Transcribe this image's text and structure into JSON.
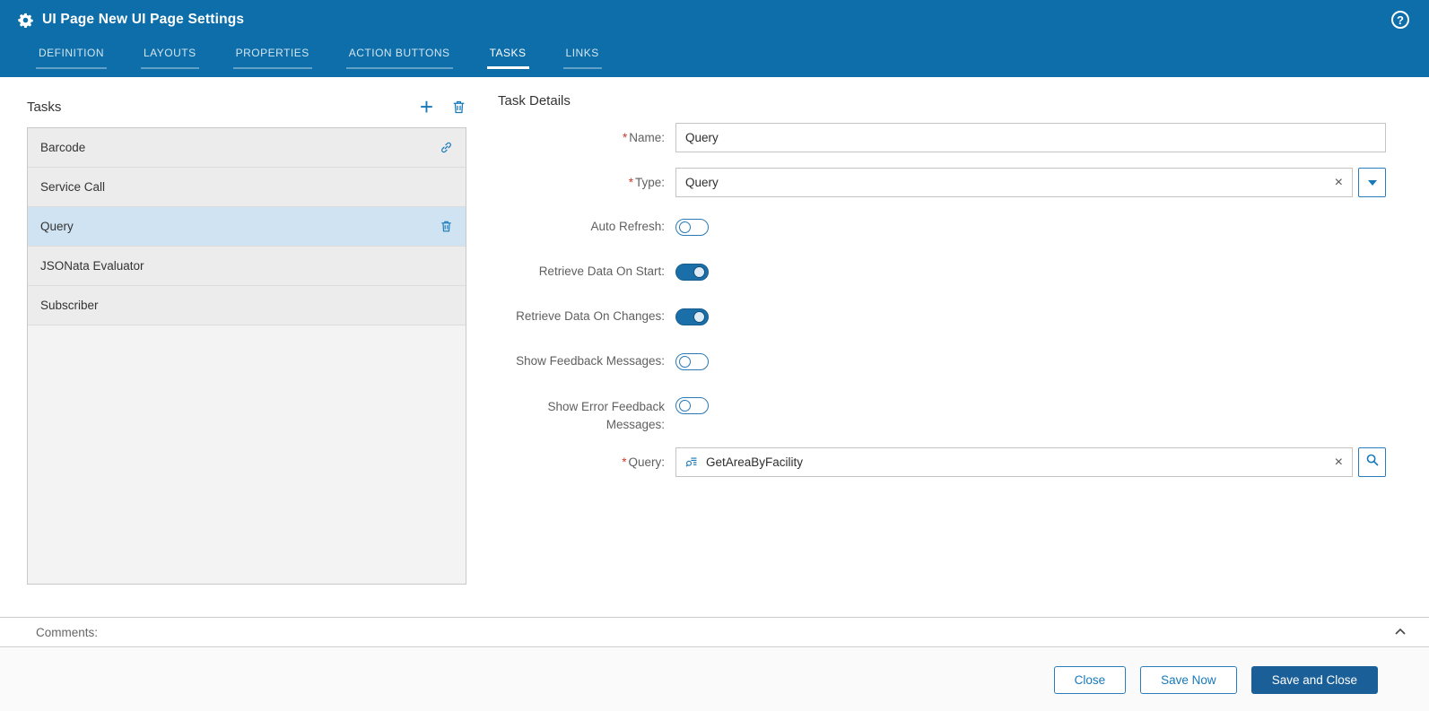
{
  "header": {
    "title": "UI Page New UI Page Settings"
  },
  "icons": {
    "plus": "+",
    "help": "?",
    "clear": "×"
  },
  "tabs": [
    {
      "label": "DEFINITION",
      "active": false
    },
    {
      "label": "LAYOUTS",
      "active": false
    },
    {
      "label": "PROPERTIES",
      "active": false
    },
    {
      "label": "ACTION BUTTONS",
      "active": false
    },
    {
      "label": "TASKS",
      "active": true
    },
    {
      "label": "LINKS",
      "active": false
    }
  ],
  "tasks_panel": {
    "title": "Tasks",
    "items": [
      {
        "label": "Barcode",
        "selected": false,
        "icon": "link-icon"
      },
      {
        "label": "Service Call",
        "selected": false
      },
      {
        "label": "Query",
        "selected": true,
        "icon": "trash-icon"
      },
      {
        "label": "JSONata Evaluator",
        "selected": false
      },
      {
        "label": "Subscriber",
        "selected": false
      }
    ]
  },
  "details": {
    "title": "Task Details",
    "required_marker": "*",
    "fields": {
      "name": {
        "label": "Name:",
        "required": true,
        "value": "Query"
      },
      "type": {
        "label": "Type:",
        "required": true,
        "value": "Query"
      },
      "auto_refresh": {
        "label": "Auto Refresh:",
        "on": false
      },
      "retrieve_on_start": {
        "label": "Retrieve Data On Start:",
        "on": true
      },
      "retrieve_on_changes": {
        "label": "Retrieve Data On Changes:",
        "on": true
      },
      "show_feedback": {
        "label": "Show Feedback Messages:",
        "on": false
      },
      "show_error_feedback": {
        "label": "Show Error Feedback Messages:",
        "on": false
      },
      "query": {
        "label": "Query:",
        "required": true,
        "value": "GetAreaByFacility"
      }
    }
  },
  "comments": {
    "label": "Comments:"
  },
  "footer": {
    "close": "Close",
    "save_now": "Save Now",
    "save_and_close": "Save and Close"
  },
  "colors": {
    "header_bg": "#0d6eaa",
    "accent": "#1779ba",
    "primary_button": "#1a5f98",
    "selected_row": "#cfe3f2",
    "required": "#cc3a28"
  }
}
